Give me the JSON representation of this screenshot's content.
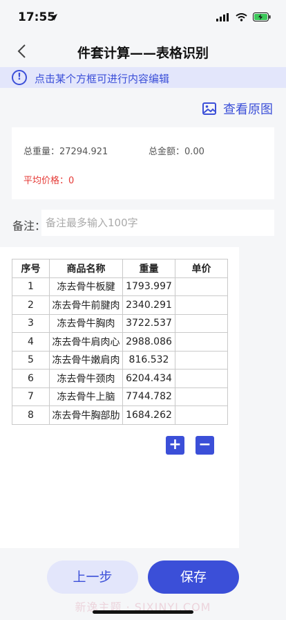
{
  "status": {
    "time": "17:55"
  },
  "nav": {
    "title": "件套计算——表格识别"
  },
  "notice": {
    "text": "点击某个方框可进行内容编辑",
    "icon": "info-icon"
  },
  "view_original": {
    "label": "查看原图",
    "icon": "image-icon"
  },
  "summary": {
    "total_weight": "总重量：27294.921",
    "total_amount": "总金额：0.00",
    "average_price": "平均价格：0"
  },
  "remark": {
    "label": "备注：",
    "placeholder": "备注最多输入100字",
    "value": ""
  },
  "table": {
    "headers": [
      "序号",
      "商品名称",
      "重量",
      "单价"
    ],
    "rows": [
      [
        "1",
        "冻去骨牛板腱",
        "1793.997",
        ""
      ],
      [
        "2",
        "冻去骨牛前腱肉",
        "2340.291",
        ""
      ],
      [
        "3",
        "冻去骨牛胸肉",
        "3722.537",
        ""
      ],
      [
        "4",
        "冻去骨牛肩肉心",
        "2988.086",
        ""
      ],
      [
        "5",
        "冻去骨牛嫩肩肉",
        "816.532",
        ""
      ],
      [
        "6",
        "冻去骨牛颈肉",
        "6204.434",
        ""
      ],
      [
        "7",
        "冻去骨牛上脑",
        "7744.782",
        ""
      ],
      [
        "8",
        "冻去骨牛胸部肋",
        "1684.262",
        ""
      ]
    ]
  },
  "actions": {
    "add": "+",
    "remove": "−",
    "prev": "上一步",
    "save": "保存"
  },
  "watermark": "新逸主题 · SIXINYI.COM",
  "colors": {
    "accent": "#3b4fd8",
    "notice_bg": "#e3e6fb",
    "warning": "#e53935"
  }
}
